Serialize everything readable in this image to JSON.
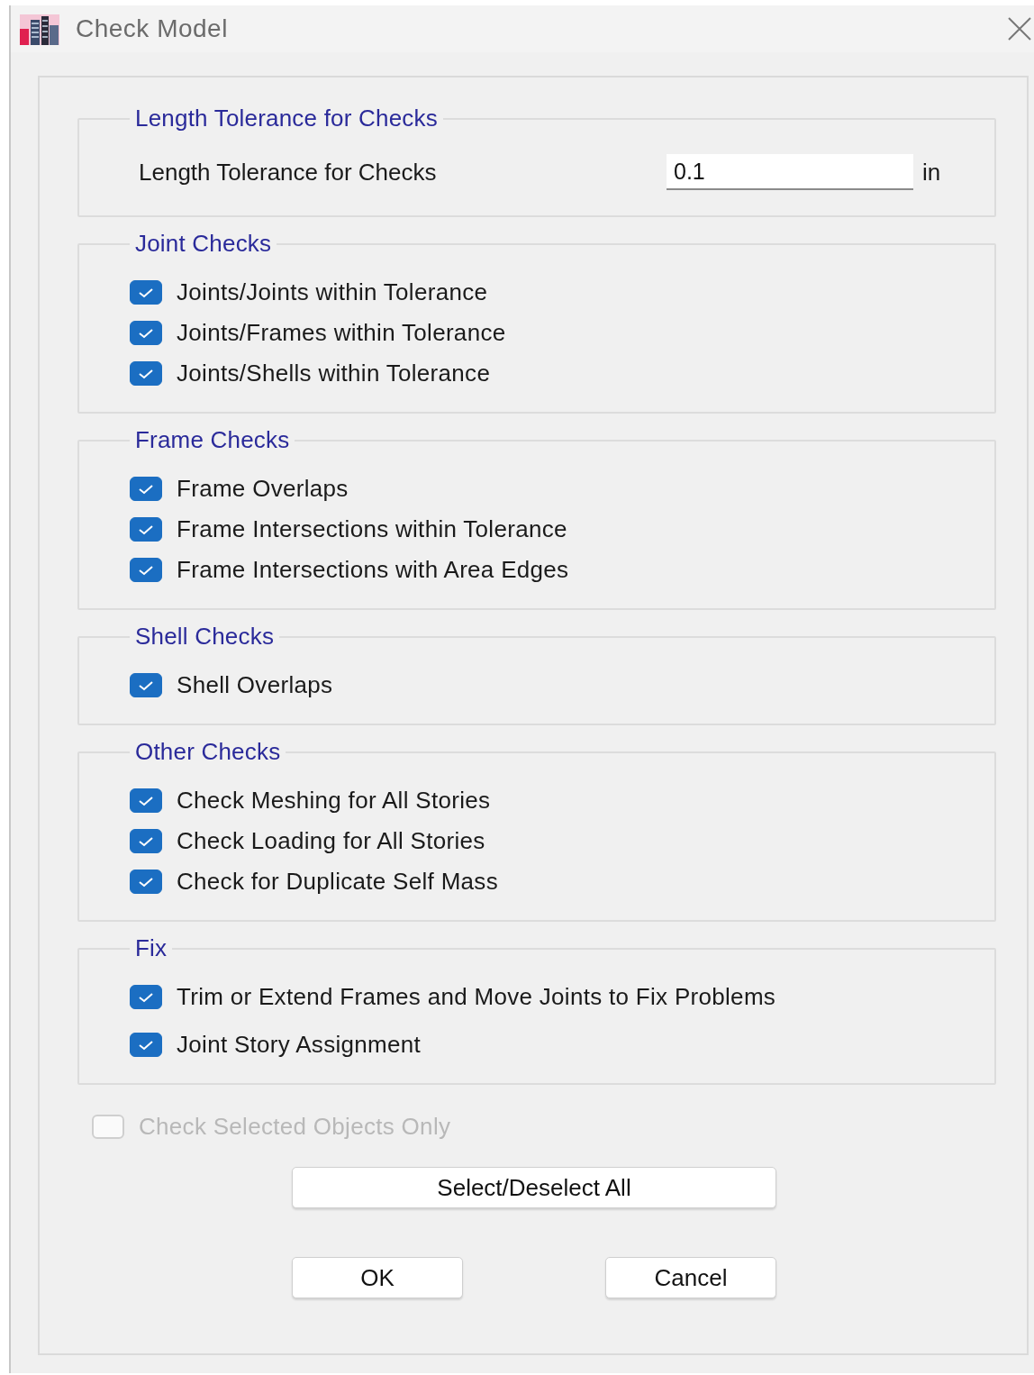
{
  "window": {
    "title": "Check Model"
  },
  "groups": [
    {
      "title": "Length Tolerance for Checks",
      "kind": "field",
      "field": {
        "label": "Length Tolerance for Checks",
        "value": "0.1",
        "unit": "in"
      }
    },
    {
      "title": "Joint Checks",
      "kind": "checks",
      "items": [
        {
          "label": "Joints/Joints within Tolerance",
          "checked": true
        },
        {
          "label": "Joints/Frames within Tolerance",
          "checked": true
        },
        {
          "label": "Joints/Shells within Tolerance",
          "checked": true
        }
      ]
    },
    {
      "title": "Frame Checks",
      "kind": "checks",
      "items": [
        {
          "label": "Frame Overlaps",
          "checked": true
        },
        {
          "label": "Frame Intersections within Tolerance",
          "checked": true
        },
        {
          "label": "Frame Intersections with Area Edges",
          "checked": true
        }
      ]
    },
    {
      "title": "Shell Checks",
      "kind": "checks",
      "items": [
        {
          "label": "Shell Overlaps",
          "checked": true
        }
      ]
    },
    {
      "title": "Other Checks",
      "kind": "checks",
      "items": [
        {
          "label": "Check Meshing for All Stories",
          "checked": true
        },
        {
          "label": "Check Loading for All Stories",
          "checked": true
        },
        {
          "label": "Check for Duplicate Self Mass",
          "checked": true
        }
      ]
    },
    {
      "title": "Fix",
      "kind": "checks",
      "items": [
        {
          "label": "Trim or Extend Frames and Move Joints to Fix Problems",
          "checked": true
        },
        {
          "label": "Joint Story Assignment",
          "checked": true
        }
      ]
    }
  ],
  "selected_only": {
    "label": "Check Selected Objects Only",
    "checked": false,
    "disabled": true
  },
  "select_all_button": "Select/Deselect All",
  "buttons": [
    "OK",
    "Cancel"
  ]
}
